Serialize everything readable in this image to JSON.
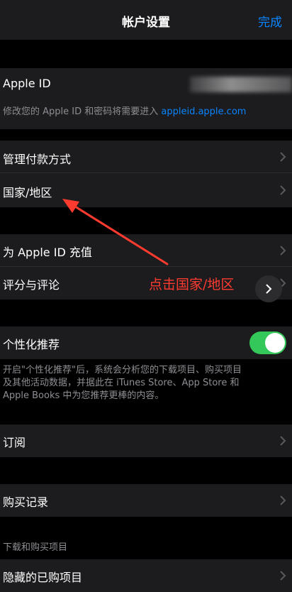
{
  "nav": {
    "title": "帐户设置",
    "done": "完成"
  },
  "apple_id": {
    "label": "Apple ID",
    "note_prefix": "修改您的 Apple ID 和密码将需要进入",
    "note_link": "appleid.apple.com"
  },
  "payment": {
    "label": "管理付款方式"
  },
  "country": {
    "label": "国家/地区"
  },
  "topup": {
    "label": "为 Apple ID 充值"
  },
  "ratings": {
    "label": "评分与评论"
  },
  "annotation": {
    "text": "点击国家/地区",
    "color": "#ff3b30"
  },
  "personalized": {
    "label": "个性化推荐",
    "enabled": true,
    "note_lines": [
      "开启\"个性化推荐\"后，系统会分析您的下载项目、购买项目",
      "及其他活动数据，并据此在 iTunes Store、App Store 和",
      "Apple Books 中为您推荐更棒的内容。"
    ]
  },
  "subscriptions": {
    "label": "订阅"
  },
  "purchase_history": {
    "label": "购买记录"
  },
  "downloads_section": {
    "header": "下载和购买项目"
  },
  "hidden_purchases": {
    "label": "隐藏的已购项目"
  },
  "colors": {
    "accent": "#0a84ff",
    "toggle_on": "#34c759",
    "annotation": "#ff3b30"
  }
}
